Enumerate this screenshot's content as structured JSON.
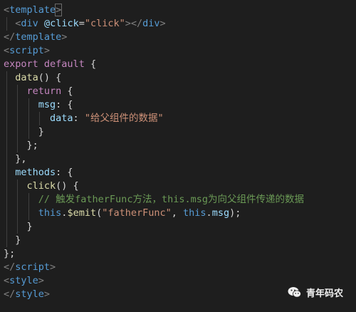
{
  "editor": {
    "lines": [
      {
        "indent": 0,
        "tokens": [
          [
            "t-tag",
            "<"
          ],
          [
            "t-kw",
            "template"
          ],
          [
            "t-tag",
            ">"
          ]
        ],
        "cursor": true
      },
      {
        "indent": 1,
        "tokens": [
          [
            "t-tag",
            "<"
          ],
          [
            "t-kw",
            "div"
          ],
          [
            "t-pun",
            " "
          ],
          [
            "t-attr",
            "@click"
          ],
          [
            "t-pun",
            "="
          ],
          [
            "t-str",
            "\"click\""
          ],
          [
            "t-tag",
            "></"
          ],
          [
            "t-kw",
            "div"
          ],
          [
            "t-tag",
            ">"
          ]
        ]
      },
      {
        "indent": 0,
        "tokens": [
          [
            "t-tag",
            "</"
          ],
          [
            "t-kw",
            "template"
          ],
          [
            "t-tag",
            ">"
          ]
        ]
      },
      {
        "indent": 0,
        "tokens": [
          [
            "t-tag",
            "<"
          ],
          [
            "t-kw",
            "script"
          ],
          [
            "t-tag",
            ">"
          ]
        ]
      },
      {
        "indent": 0,
        "tokens": [
          [
            "t-ctl",
            "export"
          ],
          [
            "t-pun",
            " "
          ],
          [
            "t-ctl",
            "default"
          ],
          [
            "t-pun",
            " {"
          ]
        ]
      },
      {
        "indent": 1,
        "tokens": [
          [
            "t-fn",
            "data"
          ],
          [
            "t-pun",
            "() {"
          ]
        ]
      },
      {
        "indent": 2,
        "tokens": [
          [
            "t-ctl",
            "return"
          ],
          [
            "t-pun",
            " {"
          ]
        ]
      },
      {
        "indent": 3,
        "tokens": [
          [
            "t-prop",
            "msg"
          ],
          [
            "t-pun",
            ": {"
          ]
        ]
      },
      {
        "indent": 4,
        "tokens": [
          [
            "t-prop",
            "data"
          ],
          [
            "t-pun",
            ": "
          ],
          [
            "t-str",
            "\"给父组件的数据\""
          ]
        ]
      },
      {
        "indent": 3,
        "tokens": [
          [
            "t-pun",
            "}"
          ]
        ]
      },
      {
        "indent": 2,
        "tokens": [
          [
            "t-pun",
            "};"
          ]
        ]
      },
      {
        "indent": 1,
        "tokens": [
          [
            "t-pun",
            "},"
          ]
        ]
      },
      {
        "indent": 1,
        "tokens": [
          [
            "t-prop",
            "methods"
          ],
          [
            "t-pun",
            ": {"
          ]
        ]
      },
      {
        "indent": 2,
        "tokens": [
          [
            "t-fn",
            "click"
          ],
          [
            "t-pun",
            "() {"
          ]
        ]
      },
      {
        "indent": 3,
        "tokens": [
          [
            "t-cmt",
            "// 触发fatherFunc方法，this.msg为向父组件传递的数据"
          ]
        ]
      },
      {
        "indent": 3,
        "tokens": [
          [
            "t-this",
            "this"
          ],
          [
            "t-pun",
            "."
          ],
          [
            "t-fn",
            "$emit"
          ],
          [
            "t-pun",
            "("
          ],
          [
            "t-str",
            "\"fatherFunc\""
          ],
          [
            "t-pun",
            ", "
          ],
          [
            "t-this",
            "this"
          ],
          [
            "t-pun",
            "."
          ],
          [
            "t-prop",
            "msg"
          ],
          [
            "t-pun",
            ");"
          ]
        ]
      },
      {
        "indent": 2,
        "tokens": [
          [
            "t-pun",
            "}"
          ]
        ]
      },
      {
        "indent": 1,
        "tokens": [
          [
            "t-pun",
            "}"
          ]
        ]
      },
      {
        "indent": 0,
        "tokens": [
          [
            "t-pun",
            "};"
          ]
        ]
      },
      {
        "indent": 0,
        "tokens": [
          [
            "t-tag",
            "</"
          ],
          [
            "t-kw",
            "script"
          ],
          [
            "t-tag",
            ">"
          ]
        ]
      },
      {
        "indent": 0,
        "tokens": [
          [
            "t-tag",
            "<"
          ],
          [
            "t-kw",
            "style"
          ],
          [
            "t-tag",
            ">"
          ]
        ]
      },
      {
        "indent": 0,
        "tokens": [
          [
            "t-tag",
            "</"
          ],
          [
            "t-kw",
            "style"
          ],
          [
            "t-tag",
            ">"
          ]
        ]
      }
    ]
  },
  "watermark": {
    "label": "青年码农",
    "icon": "wechat-icon",
    "color": "#f0f0f0"
  },
  "theme": {
    "background": "#1e1e1e",
    "indent_guide": "#404040"
  }
}
